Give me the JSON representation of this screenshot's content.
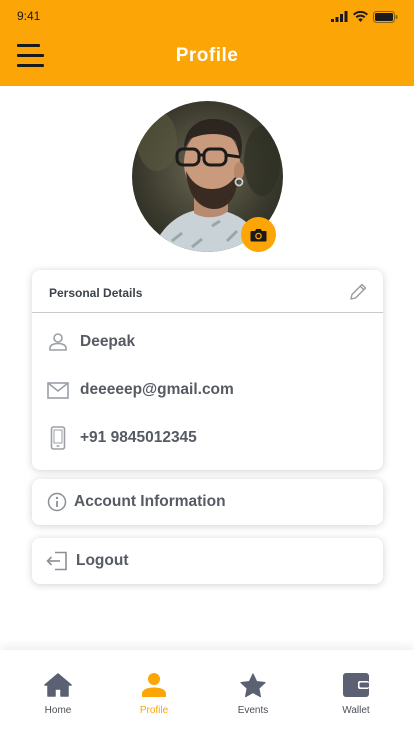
{
  "status_bar": {
    "time": "9:41"
  },
  "header": {
    "title": "Profile"
  },
  "colors": {
    "accent": "#fba507",
    "icon": "#5b6173",
    "text": "#4a4f57"
  },
  "personal_details": {
    "heading": "Personal Details",
    "name": "Deepak",
    "email": "deeeeep@gmail.com",
    "phone": "+91 9845012345"
  },
  "actions": {
    "account_information": "Account Information",
    "logout": "Logout"
  },
  "nav": {
    "items": [
      {
        "label": "Home",
        "icon": "home-icon"
      },
      {
        "label": "Profile",
        "icon": "user-icon",
        "active": true
      },
      {
        "label": "Events",
        "icon": "star-icon"
      },
      {
        "label": "Wallet",
        "icon": "wallet-icon"
      }
    ]
  }
}
